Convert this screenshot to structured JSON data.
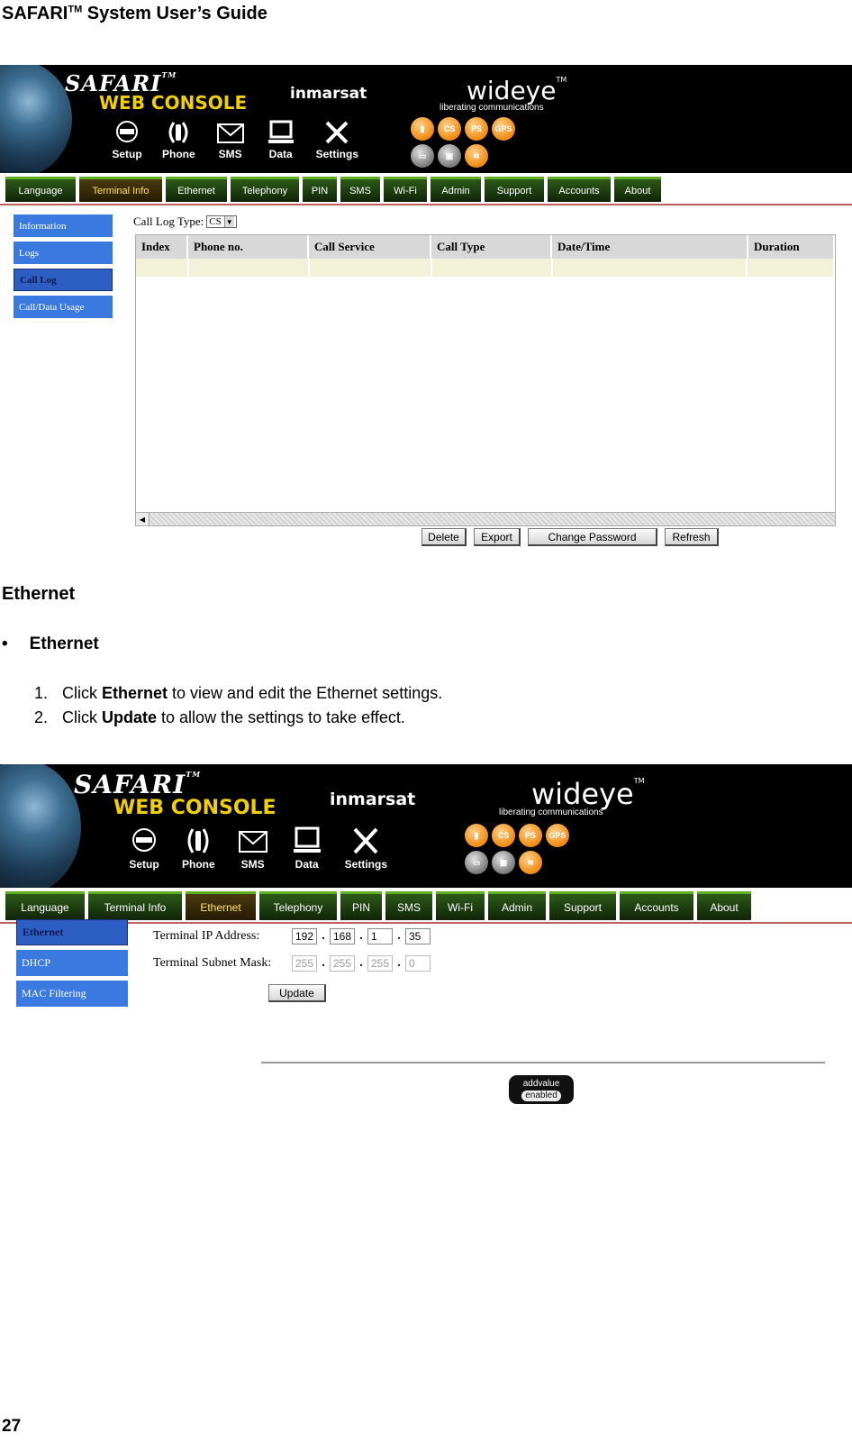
{
  "doc": {
    "header_main": "SAFARI",
    "header_tm": "TM",
    "header_rest": " System User’s Guide",
    "page_number": "27",
    "section_title": "Ethernet",
    "bullet_marker": "•",
    "bullet": "Ethernet",
    "steps": [
      {
        "num": "1.",
        "pre": "Click ",
        "bold": "Ethernet",
        "post": " to view and edit the Ethernet settings."
      },
      {
        "num": "2.",
        "pre": "Click ",
        "bold": "Update",
        "post": " to allow the settings to take effect."
      }
    ]
  },
  "banner": {
    "safari": "SAFARI",
    "tm": "TM",
    "web_console": "WEB CONSOLE",
    "inmarsat": "inmarsat",
    "wideye": "wideye",
    "tagline": "liberating communications",
    "icons": [
      {
        "label": "Setup",
        "icon": "setup-icon"
      },
      {
        "label": "Phone",
        "icon": "phone-icon"
      },
      {
        "label": "SMS",
        "icon": "sms-icon"
      },
      {
        "label": "Data",
        "icon": "data-icon"
      },
      {
        "label": "Settings",
        "icon": "settings-icon"
      }
    ],
    "status": [
      "CS",
      "PS",
      "GPS"
    ],
    "addvalue_top": "addvalue",
    "addvalue_bottom": "enabled"
  },
  "tabs": [
    "Language",
    "Terminal Info",
    "Ethernet",
    "Telephony",
    "PIN",
    "SMS",
    "Wi-Fi",
    "Admin",
    "Support",
    "Accounts",
    "About"
  ],
  "shot1": {
    "active_tab": "Terminal Info",
    "leftnav": [
      "Information",
      "Logs",
      "Call Log",
      "Call/Data Usage"
    ],
    "active_nav": "Call Log",
    "call_log_type_label": "Call Log Type:",
    "call_log_type_value": "CS",
    "columns": [
      "Index",
      "Phone no.",
      "Call Service",
      "Call Type",
      "Date/Time",
      "Duration"
    ],
    "buttons": [
      "Delete",
      "Export",
      "Change Password",
      "Refresh"
    ]
  },
  "shot2": {
    "active_tab": "Ethernet",
    "leftnav": [
      "Ethernet",
      "DHCP",
      "MAC Filtering"
    ],
    "active_nav": "Ethernet",
    "ip_label": "Terminal IP Address:",
    "ip": [
      "192",
      "168",
      "1",
      "35"
    ],
    "mask_label": "Terminal Subnet Mask:",
    "mask": [
      "255",
      "255",
      "255",
      "0"
    ],
    "update_button": "Update"
  },
  "colors": {
    "banner_bg": "#000000",
    "tab_green": "#2c5a18",
    "tab_active_text": "#ffe060",
    "nav_blue": "#3a7ae0",
    "status_orange": "#f08a10"
  }
}
